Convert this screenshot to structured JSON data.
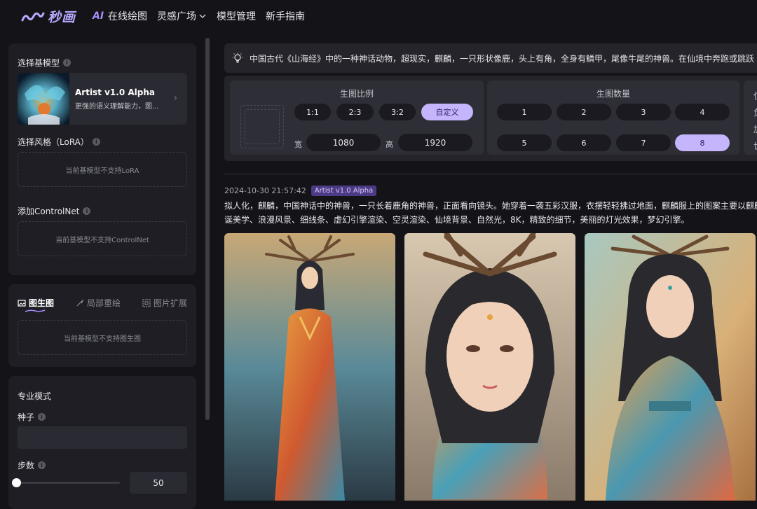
{
  "app": {
    "logo_text": "秒画",
    "nav": {
      "ai_prefix": "AI",
      "online_draw": "在线绘图",
      "inspiration": "灵感广场",
      "model_manage": "模型管理",
      "guide": "新手指南"
    }
  },
  "sidebar": {
    "base_model": {
      "label": "选择基模型",
      "name": "Artist v1.0 Alpha",
      "desc": "更强的语义理解能力，图..."
    },
    "lora": {
      "label": "选择风格（LoRA）",
      "empty": "当前基模型不支持LoRA"
    },
    "controlnet": {
      "label": "添加ControlNet",
      "empty": "当前基模型不支持ControlNet"
    },
    "img_tabs": {
      "tab1": "图生图",
      "tab2": "局部重绘",
      "tab3": "图片扩展",
      "empty": "当前基模型不支持图生图"
    },
    "pro": {
      "title": "专业模式",
      "seed_label": "种子",
      "seed_value": "",
      "steps_label": "步数",
      "steps_value": "50"
    }
  },
  "prompt": {
    "text": "中国古代《山海经》中的一种神话动物，超现实，麒麟，一只形状像鹿，头上有角，全身有鳞甲，尾像牛尾的神兽。在仙境中奔跑或跳跃，展"
  },
  "settings": {
    "ratio": {
      "title": "生图比例",
      "options": [
        "1:1",
        "2:3",
        "3:2",
        "自定义"
      ],
      "selected": "自定义",
      "width_label": "宽",
      "width_value": "1080",
      "height_label": "高",
      "height_value": "1920"
    },
    "count": {
      "title": "生图数量",
      "options": [
        "1",
        "2",
        "3",
        "4",
        "5",
        "6",
        "7",
        "8"
      ],
      "selected": "8"
    },
    "partial_col": [
      "位",
      "负",
      "加",
      "世"
    ]
  },
  "result": {
    "timestamp": "2024-10-30 21:57:42",
    "model_badge": "Artist v1.0 Alpha",
    "line1": "拟人化，麒麟，中国神话中的神兽，一只长着鹿角的神兽，正面看向镜头。她穿着一袭五彩汉服，衣摆轻轻拂过地面，麒麟服上的图案主要以麒麟为",
    "line2": "诞美学、浪漫风景、细线条、虚幻引擎渲染、空灵渲染、仙境背景、自然光，8K，精致的细节，美丽的灯光效果，梦幻引擎。"
  },
  "colors": {
    "accent": "#c4b5fd",
    "badge_bg": "#4c3b84",
    "background": "#141418",
    "panel": "#1e1e24"
  }
}
